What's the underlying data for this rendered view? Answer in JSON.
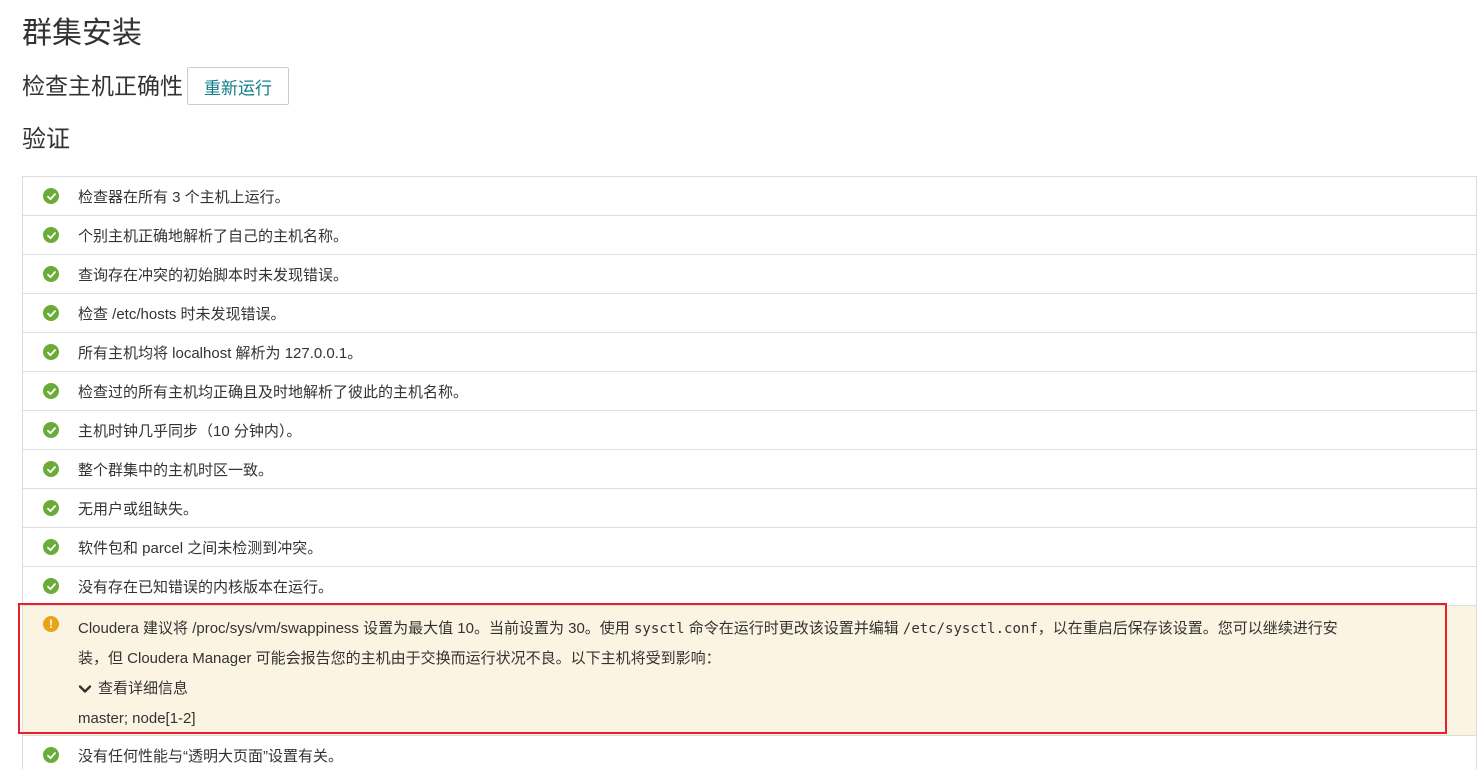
{
  "page_title": "群集安装",
  "subhead": {
    "text": "检查主机正确性",
    "rerun_label": "重新运行"
  },
  "section_title": "验证",
  "checks_before": [
    "检查器在所有 3 个主机上运行。",
    "个别主机正确地解析了自己的主机名称。",
    "查询存在冲突的初始脚本时未发现错误。",
    "检查 /etc/hosts 时未发现错误。",
    "所有主机均将 localhost 解析为 127.0.0.1。",
    "检查过的所有主机均正确且及时地解析了彼此的主机名称。",
    "主机时钟几乎同步（10 分钟内）。",
    "整个群集中的主机时区一致。",
    "无用户或组缺失。",
    "软件包和 parcel 之间未检测到冲突。",
    "没有存在已知错误的内核版本在运行。"
  ],
  "warning": {
    "line1_a": "Cloudera 建议将 /proc/sys/vm/swappiness 设置为最大值 10。当前设置为 30。使用 ",
    "line1_code1": "sysctl",
    "line1_b": " 命令在运行时更改该设置并编辑 ",
    "line1_code2": "/etc/sysctl.conf",
    "line1_c": "，以在重启后保存该设置。您可以继续进行安",
    "line2": "装，但 Cloudera Manager 可能会报告您的主机由于交换而运行状况不良。以下主机将受到影响：",
    "details_label": "查看详细信息",
    "hosts": "master; node[1-2]"
  },
  "checks_after": [
    "没有任何性能与“透明大页面”设置有关。"
  ],
  "colors": {
    "ok": "#6bab38",
    "warn": "#e8a317",
    "warn_bg": "#fcf4e2",
    "highlight": "#e8202b",
    "link": "#0f7c8c"
  },
  "icons": {
    "ok": "check-circle-icon",
    "warn": "exclamation-circle-icon",
    "toggle": "chevron-down-icon"
  }
}
